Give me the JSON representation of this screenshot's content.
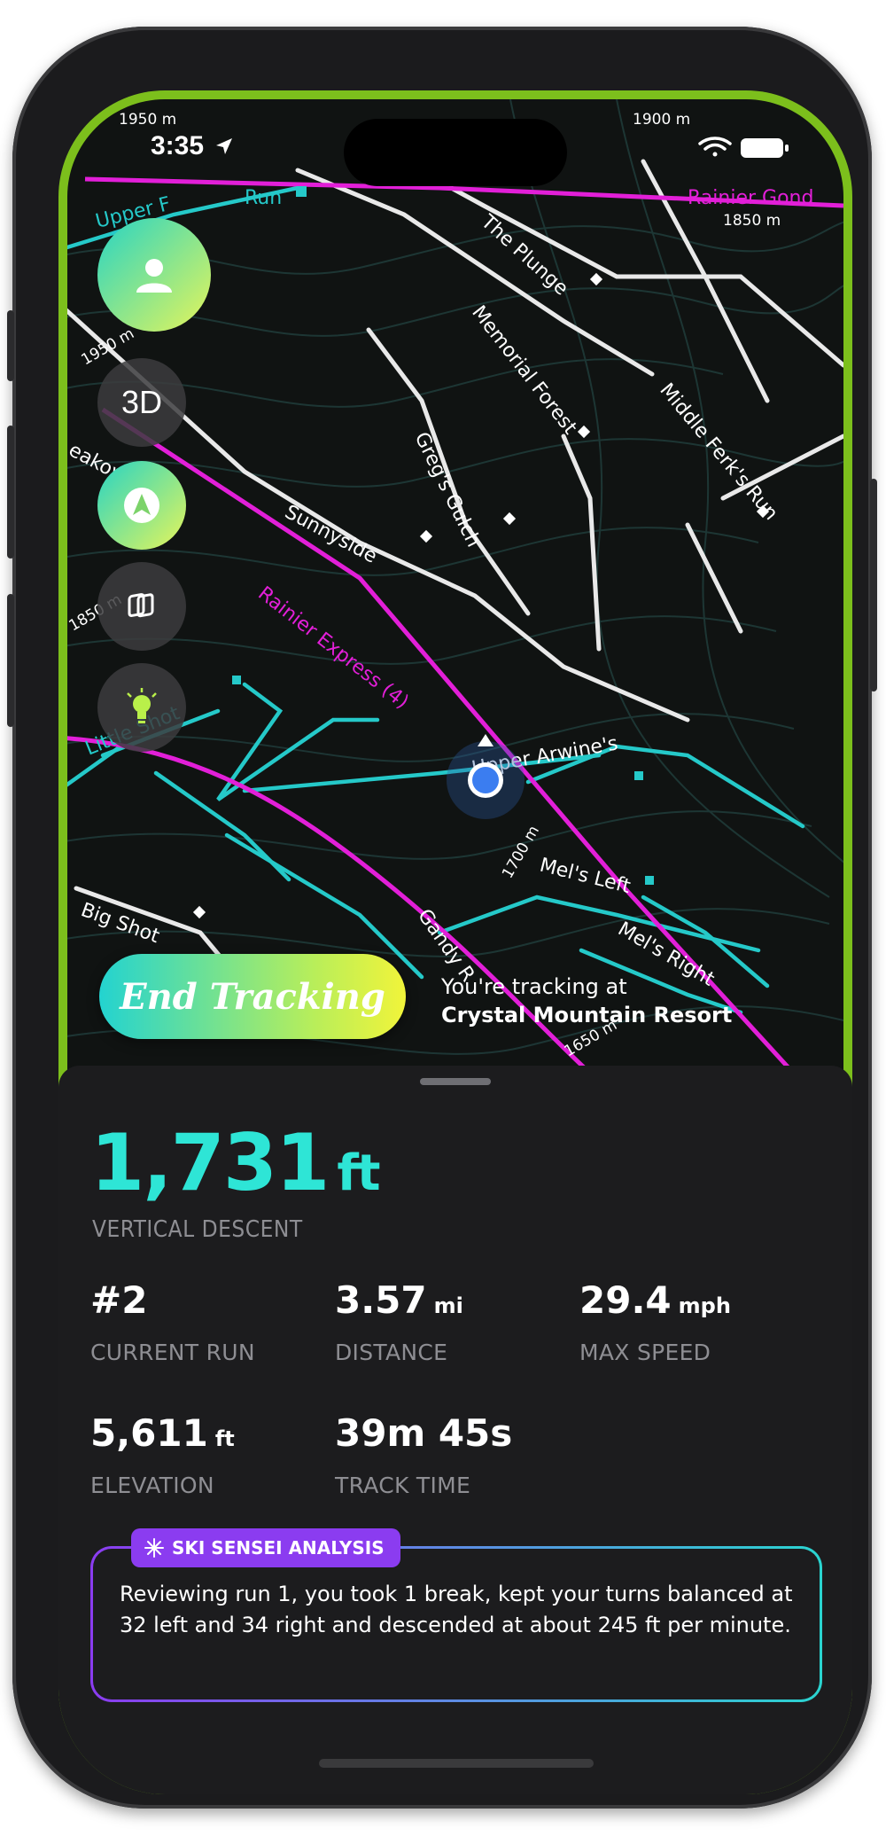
{
  "status_bar": {
    "time": "3:35"
  },
  "map": {
    "elevation_labels": [
      "1950 m",
      "1900 m",
      "1850 m",
      "1950 m",
      "1850 m",
      "1700 m",
      "1650 m"
    ],
    "runs": {
      "upper_ferks": "Upper F",
      "run": "Run",
      "the_plunge": "The Plunge",
      "memorial_forest": "Memorial Forest",
      "middle_ferks_run": "Middle Ferk's Run",
      "gregs_gulch": "Greg's Gulch",
      "breakover": "eakover",
      "sunnyside": "Sunnyside",
      "little_shot": "Little Shot",
      "upper_arwines": "Upper Arwine's",
      "mels_left": "Mel's Left",
      "mels_right": "Mel's Right",
      "big_shot": "Big Shot",
      "gandy": "Gandy R",
      "rainier_gondola": "Rainier Gond"
    },
    "lifts": {
      "rainier_express": "Rainier Express (4)"
    },
    "buttons": {
      "three_d": "3D"
    },
    "end_tracking": "End Tracking",
    "tracking_line1": "You're tracking at",
    "tracking_resort": "Crystal Mountain Resort"
  },
  "stats": {
    "vertical_descent": {
      "value": "1,731",
      "unit": "ft",
      "label": "VERTICAL DESCENT"
    },
    "current_run": {
      "value": "#2",
      "label": "CURRENT RUN"
    },
    "distance": {
      "value": "3.57",
      "unit": "mi",
      "label": "DISTANCE"
    },
    "max_speed": {
      "value": "29.4",
      "unit": "mph",
      "label": "MAX SPEED"
    },
    "elevation": {
      "value": "5,611",
      "unit": "ft",
      "label": "ELEVATION"
    },
    "track_time": {
      "value": "39m 45s",
      "label": "TRACK TIME"
    }
  },
  "analysis": {
    "badge": "SKI SENSEI ANALYSIS",
    "text": "Reviewing run 1, you took 1 break, kept your turns balanced at 32 left and 34 right and descended at about 245 ft per minute."
  },
  "colors": {
    "accent": "#2ee5d6",
    "lift": "#e21fd8",
    "run": "#25c9c9",
    "badge": "#8b3cf0",
    "frame": "#7cbf1c"
  }
}
